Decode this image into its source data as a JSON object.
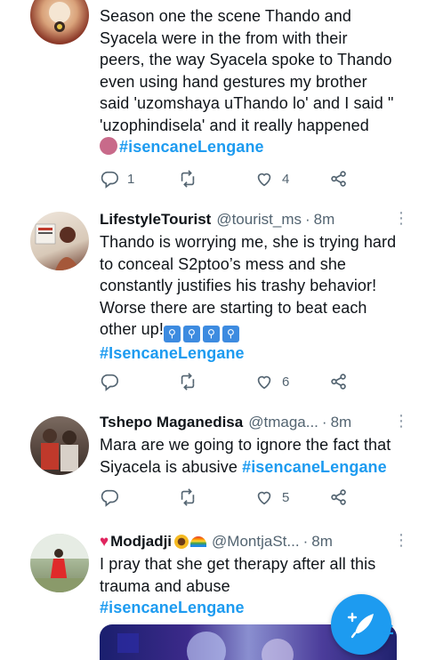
{
  "tweets": [
    {
      "text_lines": [
        "Season one the scene Thando and",
        "Syacela were in the from with their",
        "peers, the way Syacela spoke to Thando",
        "even using hand gestures my brother",
        "said 'uzomshaya uThando lo' and I said \"",
        "'uzophindisela' and it really happened"
      ],
      "hashtag": "#isencaneLengane",
      "replies": "1",
      "likes": "4"
    },
    {
      "name": "LifestyleTourist",
      "handle": "@tourist_ms",
      "time": "8m",
      "text_lines": [
        "Thando is worrying me, she is trying hard",
        "to conceal S2ptoo’s mess and she",
        "constantly justifies his trashy  behavior!",
        "Worse there are starting to beat each",
        "other up!"
      ],
      "hashtag": "#IsencaneLengane",
      "likes": "6"
    },
    {
      "name": "Tshepo Maganedisa",
      "handle": "@tmaga...",
      "time": "8m",
      "text_lines": [
        "Mara are we going to ignore the fact that",
        "Siyacela is abusive"
      ],
      "hashtag": "#isencaneLengane",
      "likes": "5"
    },
    {
      "name": "Modjadji",
      "handle": "@MontjaSt...",
      "time": "8m",
      "text_lines": [
        "I pray that she get therapy after all this",
        "trauma and abuse"
      ],
      "hashtag": "#isencaneLengane"
    }
  ],
  "icons": {
    "reply": "reply-icon",
    "retweet": "retweet-icon",
    "like": "heart-icon",
    "share": "share-icon",
    "more": "more-icon",
    "compose": "compose-icon"
  },
  "colors": {
    "accent": "#1d9bf0",
    "muted": "#536471"
  }
}
